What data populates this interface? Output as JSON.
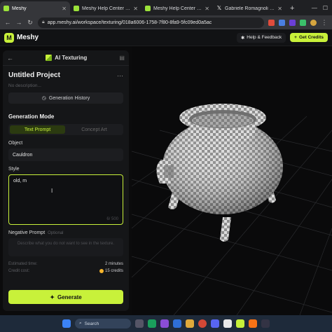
{
  "browser": {
    "tabs": [
      {
        "title": "Meshy",
        "favicon": "meshy-icon",
        "active": true
      },
      {
        "title": "Meshy Help Center | Generat",
        "favicon": "meshy-help-icon",
        "active": false
      },
      {
        "title": "Meshy Help Center | Genera",
        "favicon": "meshy-help-icon",
        "active": false
      },
      {
        "title": "Gabriele Romagnoli on X: \"H",
        "favicon": "x-icon",
        "active": false
      }
    ],
    "url": "app.meshy.ai/workspace/texturing/018a6006-1758-7f80-8fa9-5fc09ed0a5ac"
  },
  "header": {
    "logo_text": "Meshy",
    "help_label": "Help & Feedback",
    "credits_label": "Get Credits"
  },
  "panel": {
    "mode_title": "AI Texturing",
    "project_title": "Untitled Project",
    "description_placeholder": "No description...",
    "history_label": "Generation History",
    "generation_mode_title": "Generation Mode",
    "modes": [
      "Text Prompt",
      "Concept Art"
    ],
    "object_label": "Object",
    "object_value": "Cauldron",
    "style_label": "Style",
    "style_value": "old, m",
    "style_counter": "6/ 500",
    "negative_label": "Negative Prompt",
    "negative_optional": "Optional",
    "negative_placeholder": "Describe what you do not want to see in the texture.",
    "estimated_time_label": "Estimated time:",
    "estimated_time_value": "2 minutes",
    "credit_cost_label": "Credit cost:",
    "credit_cost_value": "15 credits",
    "generate_label": "Generate"
  },
  "taskbar": {
    "search_label": "Search"
  },
  "colors": {
    "accent": "#c8f13a",
    "panel_bg": "#151618",
    "viewport_bg": "#0a0a0b"
  }
}
